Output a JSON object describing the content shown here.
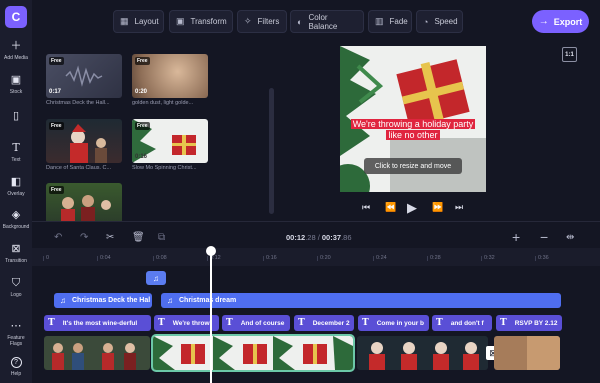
{
  "app": {
    "logo_letter": "C"
  },
  "rail": [
    {
      "label": "Add Media",
      "icon": "plus-icon"
    },
    {
      "label": "Stock",
      "icon": "stock-icon"
    },
    {
      "label": "",
      "icon": "file-music-icon"
    },
    {
      "label": "Text",
      "icon": "text-icon"
    },
    {
      "label": "Overlay",
      "icon": "overlay-icon"
    },
    {
      "label": "Background",
      "icon": "layers-icon"
    },
    {
      "label": "Transition",
      "icon": "transition-icon"
    },
    {
      "label": "Logo",
      "icon": "shield-icon"
    },
    {
      "label": "Feature Flags",
      "icon": "more-icon"
    },
    {
      "label": "Help",
      "icon": "help-icon"
    }
  ],
  "toolbar": {
    "layout": "Layout",
    "transform": "Transform",
    "filters": "Filters",
    "color_balance": "Color Balance",
    "fade": "Fade",
    "speed": "Speed",
    "export": "Export"
  },
  "media": [
    {
      "badge": "Free",
      "duration": "0:17",
      "caption": "Christmas Deck the Hall..."
    },
    {
      "badge": "Free",
      "duration": "0:20",
      "caption": "golden dust, light golde..."
    },
    {
      "badge": "Free",
      "duration": "",
      "caption": "Dance of Santa Claus. C..."
    },
    {
      "badge": "Free",
      "duration": "0:16",
      "caption": "Slow Mo Spinning Christ..."
    },
    {
      "badge": "Free",
      "duration": "",
      "caption": ""
    }
  ],
  "preview": {
    "caption": "We're throwing a holiday party like no other",
    "resize_hint": "Click to resize and move",
    "ratio": "1:1"
  },
  "timeline": {
    "current_time_main": "00:12",
    "current_time_frac": ".28",
    "total_time_main": "00:37",
    "total_time_frac": ".86",
    "ticks": [
      "0",
      "0:04",
      "0:08",
      "0:12",
      "0:16",
      "0:20",
      "0:24",
      "0:28",
      "0:32",
      "0:36"
    ],
    "audio_clips": [
      "Christmas Deck the Hal",
      "Christmas dream"
    ],
    "text_clips": [
      "It's the most wine-derful",
      "We're throwi",
      "And of course",
      "December 2",
      "Come in your b",
      "and don't f",
      "RSVP BY 2.12"
    ]
  },
  "colors": {
    "accent": "#7b61ff",
    "audio": "#4f6ef0",
    "text_track": "#5a4fd6",
    "selected_outline": "#6cc8a8"
  }
}
